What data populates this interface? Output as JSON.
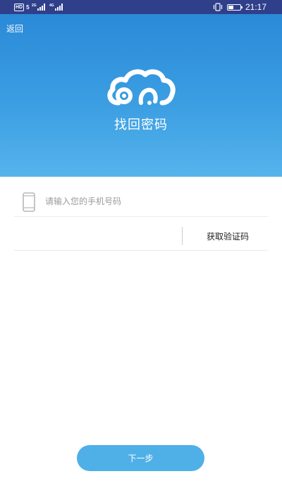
{
  "status_bar": {
    "left_badge": "HD",
    "left_badge_2": "5",
    "network_1": "2G",
    "network_2": "4G",
    "time": "21:17",
    "battery_level": 0.45,
    "icons": [
      "vibrate-icon",
      "battery-icon",
      "signal-icon"
    ]
  },
  "header": {
    "back_label": "返回",
    "title": "找回密码",
    "logo_icon": "cloud-logo-icon",
    "colors": {
      "gradient_top": "#2b8ad8",
      "gradient_bottom": "#56b4ec"
    }
  },
  "form": {
    "phone_placeholder": "请输入您的手机号码",
    "phone_value": "",
    "phone_icon": "phone-icon",
    "code_value": "",
    "get_code_label": "获取验证码"
  },
  "actions": {
    "next_label": "下一步",
    "accent": "#4fb0e7"
  }
}
